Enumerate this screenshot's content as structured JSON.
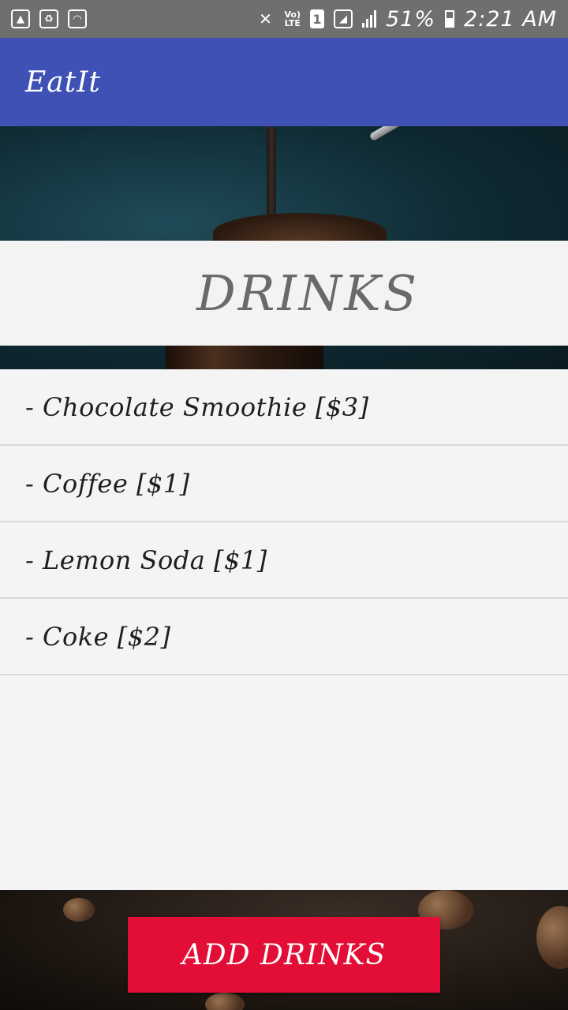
{
  "status_bar": {
    "icons_left": [
      "gallery-icon",
      "recycle-icon",
      "wifi-icon"
    ],
    "volte": "Vo)",
    "lte": "LTE",
    "sim_slot": "1",
    "battery": "51%",
    "time": "2:21 AM"
  },
  "app_bar": {
    "title": "EatIt"
  },
  "category": {
    "title": "DRINKS"
  },
  "items": [
    {
      "label": "- Chocolate Smoothie [$3]"
    },
    {
      "label": "- Coffee [$1]"
    },
    {
      "label": "- Lemon Soda [$1]"
    },
    {
      "label": "- Coke [$2]"
    }
  ],
  "actions": {
    "add_label": "ADD DRINKS"
  },
  "colors": {
    "app_bar": "#3f51b5",
    "status_bar": "#6f6f6f",
    "button": "#e30e37",
    "panel": "#f4f4f4"
  }
}
